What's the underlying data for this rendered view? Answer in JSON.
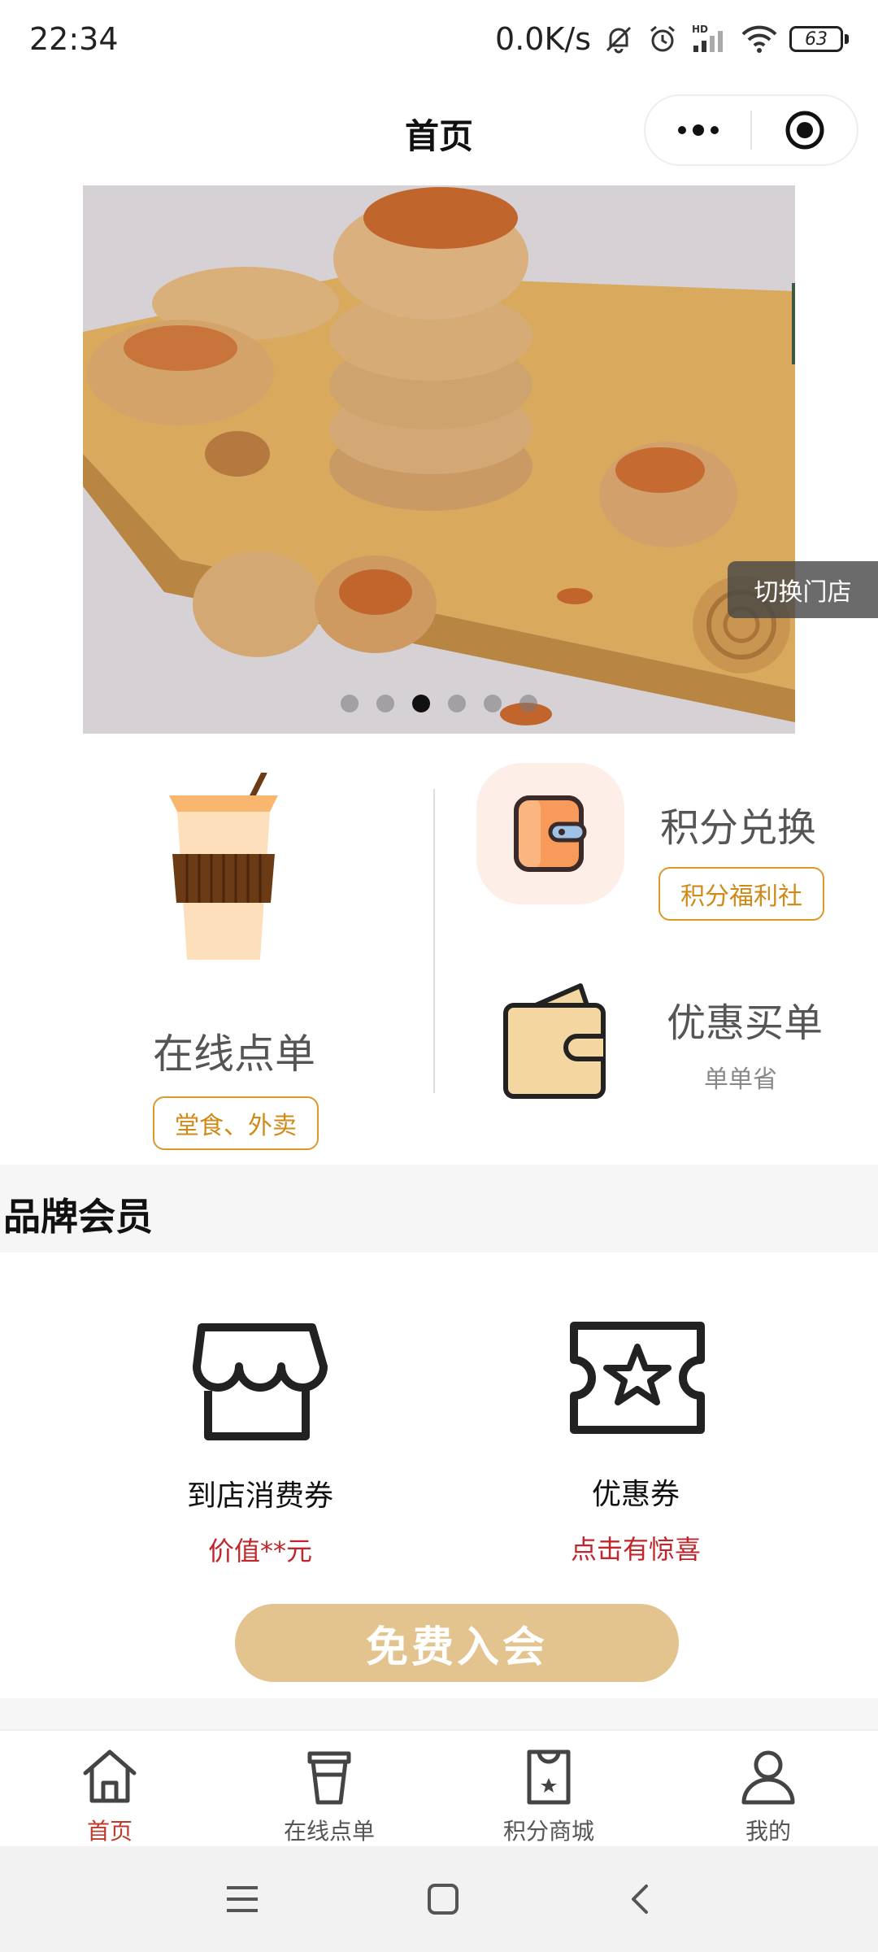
{
  "status_bar": {
    "time": "22:34",
    "net_speed": "0.0K/s",
    "battery": "63"
  },
  "nav": {
    "title": "首页"
  },
  "banner": {
    "switch_store_label": "切换门店",
    "slide_count": 6,
    "active_slide": 3
  },
  "actions": {
    "online_order": {
      "title": "在线点单",
      "tag": "堂食、外卖"
    },
    "points_exchange": {
      "title": "积分兑换",
      "tag": "积分福利社"
    },
    "discount_pay": {
      "title": "优惠买单",
      "sub": "单单省"
    }
  },
  "member": {
    "section_title": "品牌会员",
    "store_voucher": {
      "label": "到店消费券",
      "sub": "价值**元"
    },
    "coupon": {
      "label": "优惠券",
      "sub": "点击有惊喜"
    },
    "join_label": "免费入会"
  },
  "tabs": [
    {
      "label": "首页",
      "icon": "home-icon",
      "active": true
    },
    {
      "label": "在线点单",
      "icon": "cup-icon",
      "active": false
    },
    {
      "label": "积分商城",
      "icon": "shopping-bag-icon",
      "active": false
    },
    {
      "label": "我的",
      "icon": "user-icon",
      "active": false
    }
  ],
  "colors": {
    "accent": "#c0392b",
    "gold": "#d08a17",
    "join_button": "#e3c48e",
    "coupon_red": "#c0262c"
  }
}
